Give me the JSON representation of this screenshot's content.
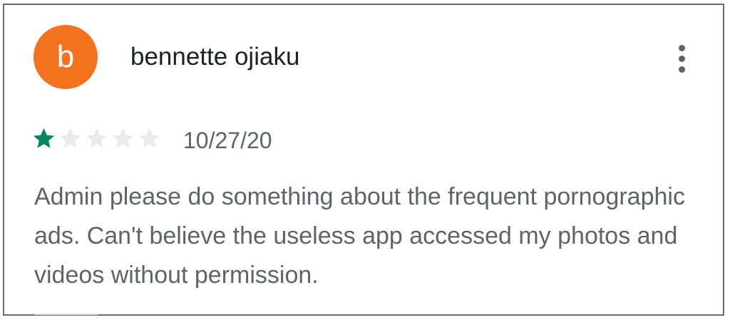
{
  "review": {
    "avatar_letter": "b",
    "avatar_color": "#f4711f",
    "author": "bennette ojiaku",
    "menu_icon": "more-vert-icon",
    "rating": 1,
    "rating_max": 5,
    "star_filled_color": "#01875f",
    "star_empty_color": "#e8eaed",
    "date": "10/27/20",
    "text": "Admin please do something about the frequent pornographic ads. Can't believe the useless app accessed my photos and videos without permission."
  }
}
